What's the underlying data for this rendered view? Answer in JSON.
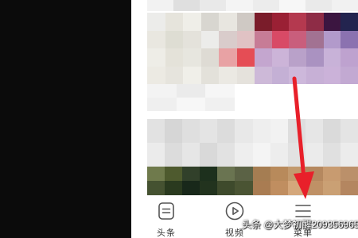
{
  "bottom_nav": {
    "items": [
      {
        "label": "头条",
        "icon": "news-list-icon"
      },
      {
        "label": "视频",
        "icon": "play-circle-icon"
      },
      {
        "label": "菜单",
        "icon": "hamburger-menu-icon"
      }
    ]
  },
  "annotation": {
    "arrow_color": "#e8202a",
    "points_to": "hamburger-menu-icon"
  },
  "watermark": {
    "text": "头条 @大梦初醒209356965"
  },
  "colors": {
    "accent": "#e8202a",
    "nav_icon": "#555555",
    "nav_label": "#333333"
  },
  "feed": {
    "top_strip": [
      "#f2f2f2",
      "#dfdfdf",
      "#e9e9e9",
      "#f4f4f4",
      "#ececec",
      "#f7f7f7",
      "#eaeaea",
      "#f1f1f1"
    ],
    "card1_left": [
      "#ececea",
      "#e6e4dc",
      "#efeee8",
      "#d8d6d0",
      "#e8e6e0",
      "#cfc9c4",
      "#e9e7e0",
      "#deddd3",
      "#e4e2db",
      "#ececea",
      "#d9cccb",
      "#e0c2c4",
      "#eeede7",
      "#e4e2d9",
      "#e7e6df",
      "#dedbd4",
      "#e8a2a4",
      "#e54d55",
      "#eceae3",
      "#e6e4dd",
      "#f0efe9",
      "#e3e1da",
      "#ebe9e3",
      "#e5e2dc"
    ],
    "card1_right": [
      "#7a1c2a",
      "#9a2034",
      "#b4394f",
      "#8e2c46",
      "#3b1540",
      "#23244f",
      "#c77c96",
      "#d84a66",
      "#c95e7c",
      "#a27292",
      "#b29acb",
      "#8b72b0",
      "#c4a6cf",
      "#ccb4d8",
      "#b9a1c9",
      "#aa92c1",
      "#c8b2d8",
      "#bea2cf",
      "#cdb9d8",
      "#c4b0d5",
      "#cdb8db",
      "#c7b0d6",
      "#cbb2d9",
      "#c2a9d2"
    ],
    "card1_caption": [
      "#f3f3f3",
      "#ebebeb",
      "#f6f6f6",
      "#efefef",
      "#f7f7f7",
      "#f0f0f0"
    ],
    "card2": [
      "#e2e2e2",
      "#d6d6d6",
      "#dfdfdf",
      "#e4e4e4",
      "#dcdcdc",
      "#e8e8e8",
      "#eeeeee",
      "#f2f2f2",
      "#dedede",
      "#e6e6e6",
      "#dadada",
      "#e4e4e4",
      "#ebebeb",
      "#dcdcdc",
      "#e6e6e6",
      "#d9d9d9",
      "#e2e2e2",
      "#eeeeee",
      "#f4f4f4",
      "#ededed",
      "#e2e2e2",
      "#ebebeb",
      "#e0e0e0",
      "#ececec"
    ],
    "card3": [
      "#6f7a4c",
      "#4e5a2e",
      "#31402a",
      "#1d301d",
      "#6a7451",
      "#5b6245",
      "#a57d52",
      "#b88a5b",
      "#c29a6e",
      "#b5885f",
      "#c89b70",
      "#bb906a",
      "#455231",
      "#2a3a1f",
      "#18281a",
      "#22331e",
      "#3e4a2c",
      "#4a5433",
      "#a97c52",
      "#c08e60",
      "#d4a77b",
      "#bf9166",
      "#caa074",
      "#b48660"
    ]
  }
}
